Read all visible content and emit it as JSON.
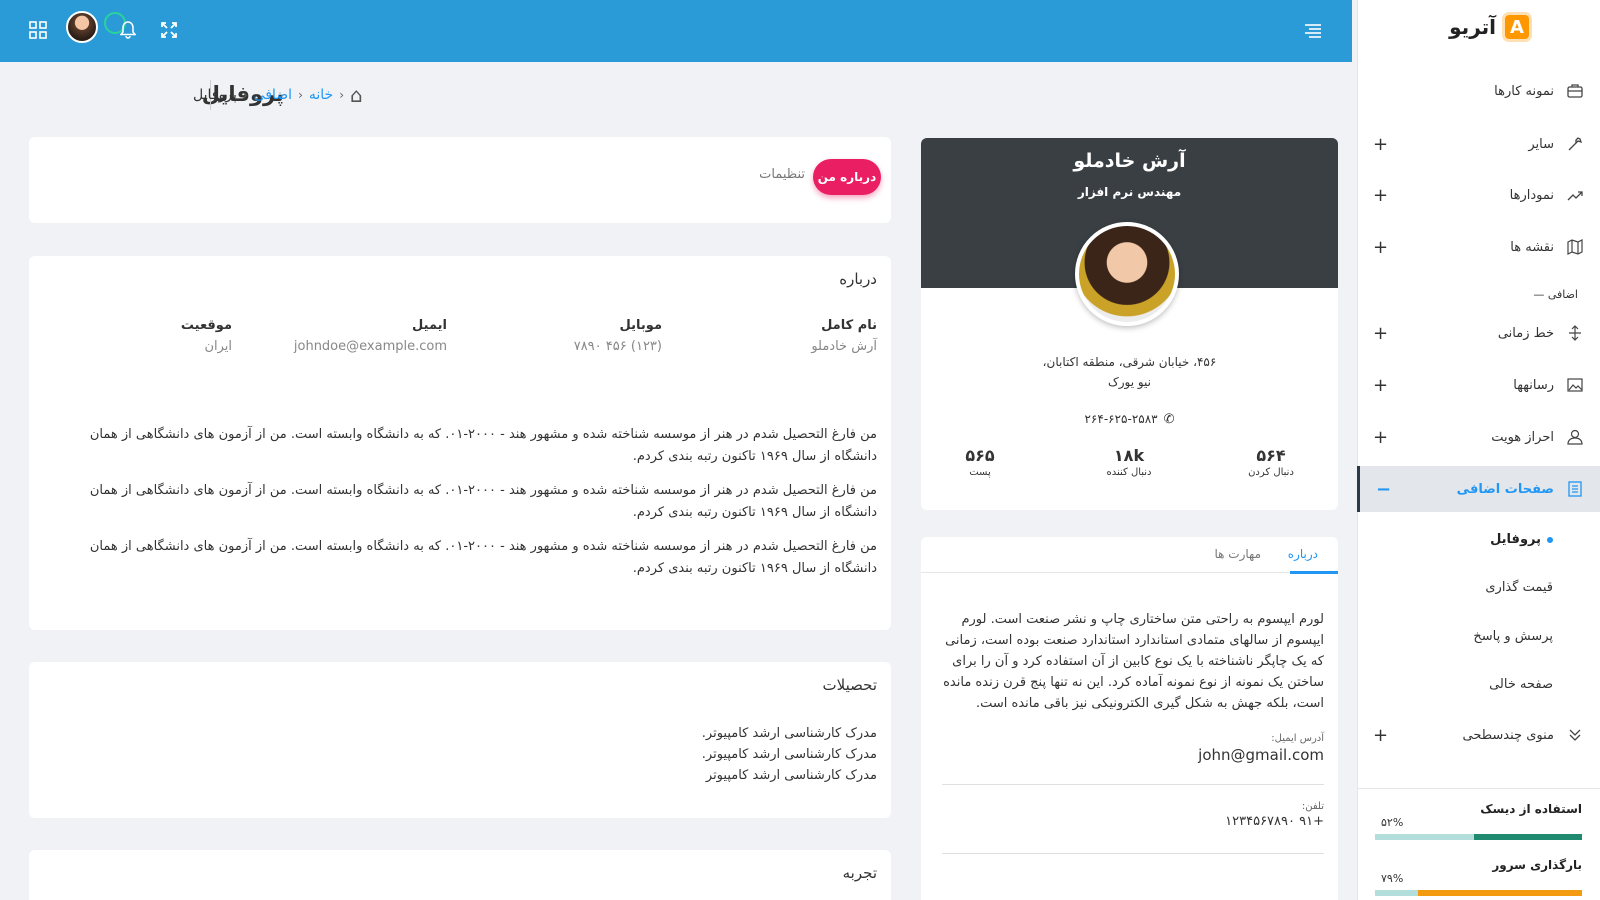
{
  "brand": {
    "logo_letter": "A",
    "name": "آتریو"
  },
  "sidebar": {
    "items": [
      {
        "label": "نمونه کارها",
        "icon": "briefcase-icon",
        "expandable": false
      },
      {
        "label": "سایر",
        "icon": "tools-icon",
        "expandable": true
      },
      {
        "label": "نمودارها",
        "icon": "trending-up-icon",
        "expandable": true
      },
      {
        "label": "نقشه ها",
        "icon": "map-icon",
        "expandable": true
      },
      {
        "label": "خط زمانی",
        "icon": "timeline-icon",
        "expandable": true
      },
      {
        "label": "رسانهها",
        "icon": "image-icon",
        "expandable": true
      },
      {
        "label": "احراز هویت",
        "icon": "user-icon",
        "expandable": true
      },
      {
        "label": "صفحات اضافی",
        "icon": "document-icon",
        "expandable": true,
        "active": true
      },
      {
        "label": "منوی چندسطحی",
        "icon": "chevron-double-icon",
        "expandable": true
      }
    ],
    "section_label": "اضافی",
    "subitems": [
      "پروفایل",
      "قیمت گذاری",
      "پرسش و پاسخ",
      "صفحه خالی"
    ],
    "usage": [
      {
        "label": "استفاده از دیسک",
        "percent_text": "۵۲%",
        "value": 0.52,
        "color": "#1f8a70"
      },
      {
        "label": "بارگذاری سرور",
        "percent_text": "۷۹%",
        "value": 0.79,
        "color": "#f39c12"
      }
    ]
  },
  "topbar": {
    "icons": [
      "apps-icon",
      "avatar",
      "bell-icon",
      "fullscreen-icon",
      "menu-icon"
    ]
  },
  "header": {
    "title": "پروفایل",
    "breadcrumb": {
      "home": "خانه",
      "middle": "اضافی",
      "current": "پروفایل"
    }
  },
  "tabs_card": {
    "active_tab": "درباره من",
    "other_tab": "تنظیمات"
  },
  "about": {
    "title": "درباره",
    "fields": [
      {
        "label": "نام کامل",
        "value": "آرش خادملو"
      },
      {
        "label": "موبایل",
        "value": "(۱۲۳) ۴۵۶ ۷۸۹۰"
      },
      {
        "label": "ایمیل",
        "value": "johndoe@example.com"
      },
      {
        "label": "موقعیت",
        "value": "ایران"
      }
    ],
    "paragraphs": [
      "من فارغ التحصیل شدم در هنر از موسسه شناخته شده و مشهور هند - ۲۰۰۰-۰۱. که به دانشگاه وابسته است. من از آزمون های دانشگاهی از همان دانشگاه از سال ۱۹۶۹ تاکنون رتبه بندی کردم.",
      "من فارغ التحصیل شدم در هنر از موسسه شناخته شده و مشهور هند - ۲۰۰۰-۰۱. که به دانشگاه وابسته است. من از آزمون های دانشگاهی از همان دانشگاه از سال ۱۹۶۹ تاکنون رتبه بندی کردم.",
      "من فارغ التحصیل شدم در هنر از موسسه شناخته شده و مشهور هند - ۲۰۰۰-۰۱. که به دانشگاه وابسته است. من از آزمون های دانشگاهی از همان دانشگاه از سال ۱۹۶۹ تاکنون رتبه بندی کردم."
    ]
  },
  "education": {
    "title": "تحصیلات",
    "lines": [
      "مدرک کارشناسی ارشد کامپیوتر.",
      "مدرک کارشناسی ارشد کامپیوتر.",
      "مدرک کارشناسی ارشد کامپیوتر"
    ]
  },
  "experience": {
    "title": "تجربه"
  },
  "profile": {
    "name": "آرش خادملو",
    "role": "مهندس نرم افزار",
    "address_line1": "۴۵۶، خیابان شرقی، منطقه اکتابان،",
    "address_line2": "نیو یورک",
    "phone": "۲۶۴-۶۲۵-۲۵۸۳",
    "stats": [
      {
        "num": "۵۶۴",
        "label": "دنبال کردن"
      },
      {
        "num": "۱۸k",
        "label": "دنبال کننده"
      },
      {
        "num": "۵۶۵",
        "label": "پست"
      }
    ]
  },
  "about_card": {
    "tabs": [
      "درباره",
      "مهارت ها"
    ],
    "text": "لورم ایپسوم به راحتی متن ساختاری چاپ و نشر صنعت است. لورم ایپسوم از سالهای متمادی استاندارد استاندارد صنعت بوده است، زمانی که یک چاپگر ناشناخته با یک نوع کابین از آن استفاده کرد و آن را برای ساختن یک نمونه از نوع نمونه آماده کرد. این نه تنها پنج قرن زنده مانده است، بلکه جهش به شکل گیری الکترونیکی نیز باقی مانده است.",
    "email_label": "آدرس ایمیل:",
    "email": "john@gmail.com",
    "phone_label": "تلفن:",
    "phone": "+۹۱ ۱۲۳۴۵۶۷۸۹۰"
  }
}
